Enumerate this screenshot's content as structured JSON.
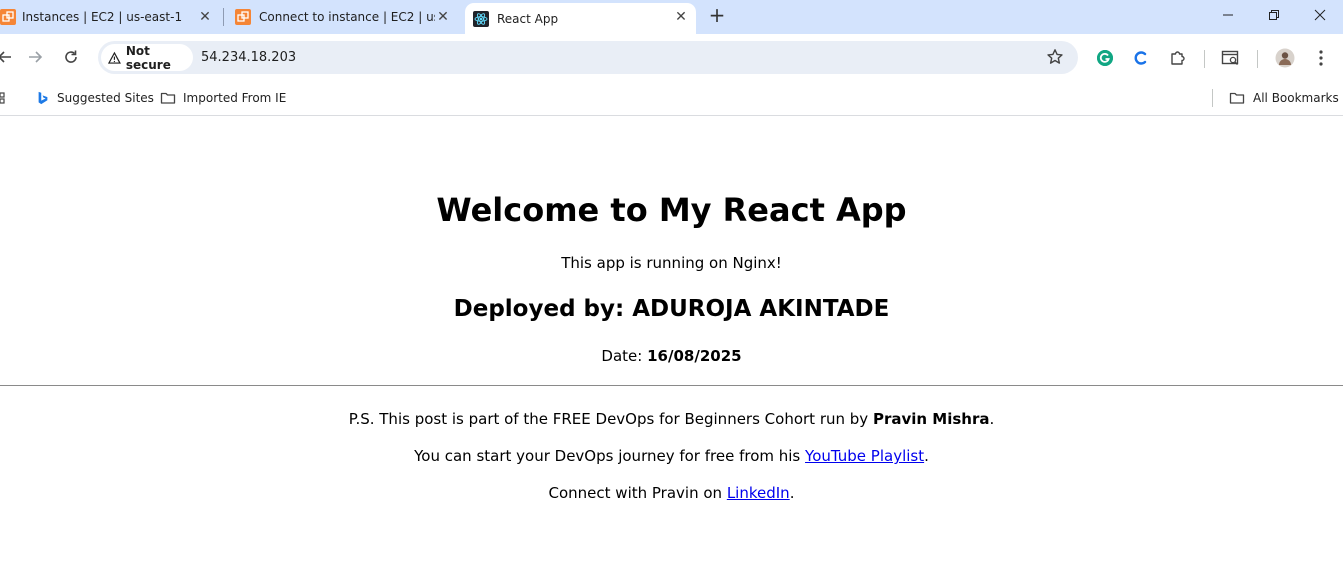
{
  "tabs": [
    {
      "title": "Instances | EC2 | us-east-1",
      "favicon": "aws-icon",
      "active": false
    },
    {
      "title": "Connect to instance | EC2 | us-e",
      "favicon": "aws-icon",
      "active": false
    },
    {
      "title": "React App",
      "favicon": "react-icon",
      "active": true
    }
  ],
  "toolbar": {
    "security_label": "Not secure",
    "url": "54.234.18.203"
  },
  "bookmarks": {
    "suggested": "Suggested Sites",
    "imported": "Imported From IE",
    "all": "All Bookmarks"
  },
  "page": {
    "heading": "Welcome to My React App",
    "subtitle": "This app is running on Nginx!",
    "deployed_prefix": "Deployed by: ",
    "deployed_name": "ADUROJA AKINTADE",
    "date_prefix": "Date: ",
    "date_value": "16/08/2025",
    "ps_prefix": "P.S. This post is part of the FREE DevOps for Beginners Cohort run by ",
    "ps_name": "Pravin Mishra",
    "ps_suffix": ".",
    "yt_prefix": "You can start your DevOps journey for free from his ",
    "yt_link": "YouTube Playlist",
    "yt_suffix": ".",
    "li_prefix": "Connect with Pravin on ",
    "li_link": "LinkedIn",
    "li_suffix": "."
  },
  "colors": {
    "tabstrip": "#d3e3fd",
    "omnibox": "#e9eef6",
    "link": "#0000ee",
    "aws": "#f58536"
  }
}
